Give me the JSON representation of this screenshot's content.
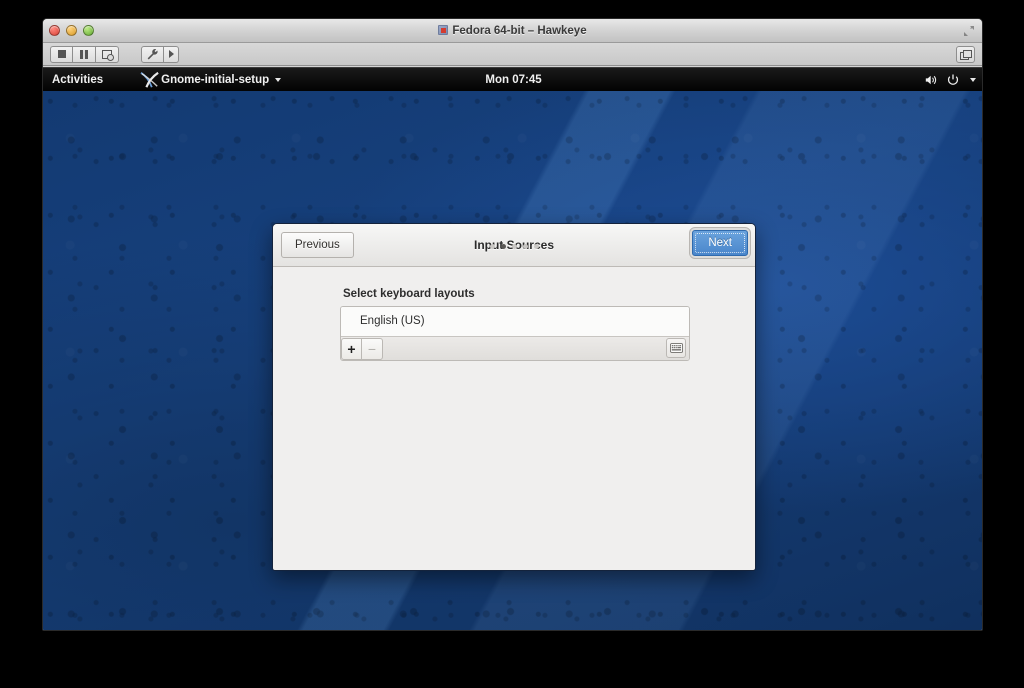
{
  "host_window": {
    "title": "Fedora 64-bit – Hawkeye",
    "title_icon": "fedora-vm-icon",
    "traffic_lights": [
      {
        "name": "close-button",
        "label": "",
        "color": "#d84135"
      },
      {
        "name": "minimize-button",
        "label": "",
        "color": "#d89b28"
      },
      {
        "name": "maximize-button",
        "label": "",
        "color": "#62a832"
      }
    ],
    "fullscreen_icon": "fullscreen-expand-icon",
    "toolbar": {
      "groups": [
        {
          "name": "vm-power-group",
          "buttons": [
            {
              "name": "stop-vm-button",
              "icon": "stop-square-icon",
              "label": ""
            },
            {
              "name": "pause-vm-button",
              "icon": "pause-icon",
              "label": ""
            },
            {
              "name": "snapshot-button",
              "icon": "screen-snapshot-icon",
              "label": ""
            }
          ]
        },
        {
          "name": "vm-settings-group",
          "buttons": [
            {
              "name": "settings-button",
              "icon": "wrench-icon",
              "label": ""
            },
            {
              "name": "settings-dropdown-button",
              "icon": "caret-right-icon",
              "label": ""
            }
          ]
        }
      ],
      "scale_button": {
        "name": "scale-display-button",
        "icon": "windows-stack-icon",
        "label": ""
      }
    }
  },
  "gnome_topbar": {
    "activities_label": "Activities",
    "app_menu": {
      "icon": "xorg-x-icon",
      "label": "Gnome-initial-setup",
      "caret": "chevron-down-icon"
    },
    "clock": "Mon 07:45",
    "status_icons": [
      {
        "name": "volume-icon",
        "glyph": "volume"
      },
      {
        "name": "power-icon",
        "glyph": "power"
      },
      {
        "name": "status-menu-caret-icon",
        "glyph": "caret-down"
      }
    ]
  },
  "desktop": {
    "wallpaper_name": "fedora-blue-wallpaper",
    "base_color": "#17417e",
    "accent_color": "#1c4b93"
  },
  "setup_dialog": {
    "title": "Input Sources",
    "previous_label": "Previous",
    "next_label": "Next",
    "next_accent_color": "#4a86cb",
    "section_label": "Select keyboard layouts",
    "layouts": [
      {
        "name": "layout-english-us",
        "label": "English (US)"
      }
    ],
    "list_toolbar": {
      "add_label": "+",
      "remove_label": "−",
      "remove_enabled": false,
      "keyboard_preview_icon": "keyboard-icon"
    },
    "page_dots": {
      "count": 5,
      "active_index": 1
    }
  }
}
